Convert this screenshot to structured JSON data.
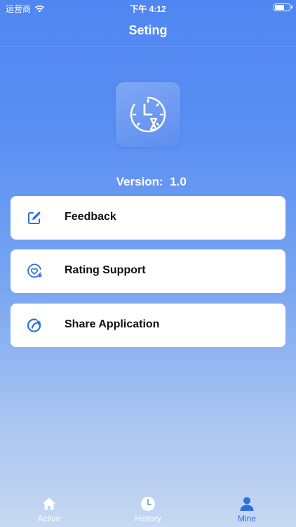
{
  "status_bar": {
    "carrier": "运营商",
    "time": "下午 4:12",
    "battery_level": 0.6
  },
  "nav": {
    "title": "Seting"
  },
  "app": {
    "icon": "clock-hourglass-icon",
    "version_label": "Version:  1.0"
  },
  "menu": {
    "items": [
      {
        "label": "Feedback",
        "icon": "edit-icon"
      },
      {
        "label": "Rating Support",
        "icon": "heart-rating-icon"
      },
      {
        "label": "Share Application",
        "icon": "share-icon"
      }
    ]
  },
  "tabbar": {
    "tabs": [
      {
        "label": "Active",
        "icon": "home-icon"
      },
      {
        "label": "History",
        "icon": "clock-icon"
      },
      {
        "label": "Mine",
        "icon": "person-icon",
        "active": true
      }
    ]
  },
  "colors": {
    "accent": "#2f6fdc",
    "background_top": "#4f86f1",
    "background_bottom": "#c6d8f2"
  }
}
